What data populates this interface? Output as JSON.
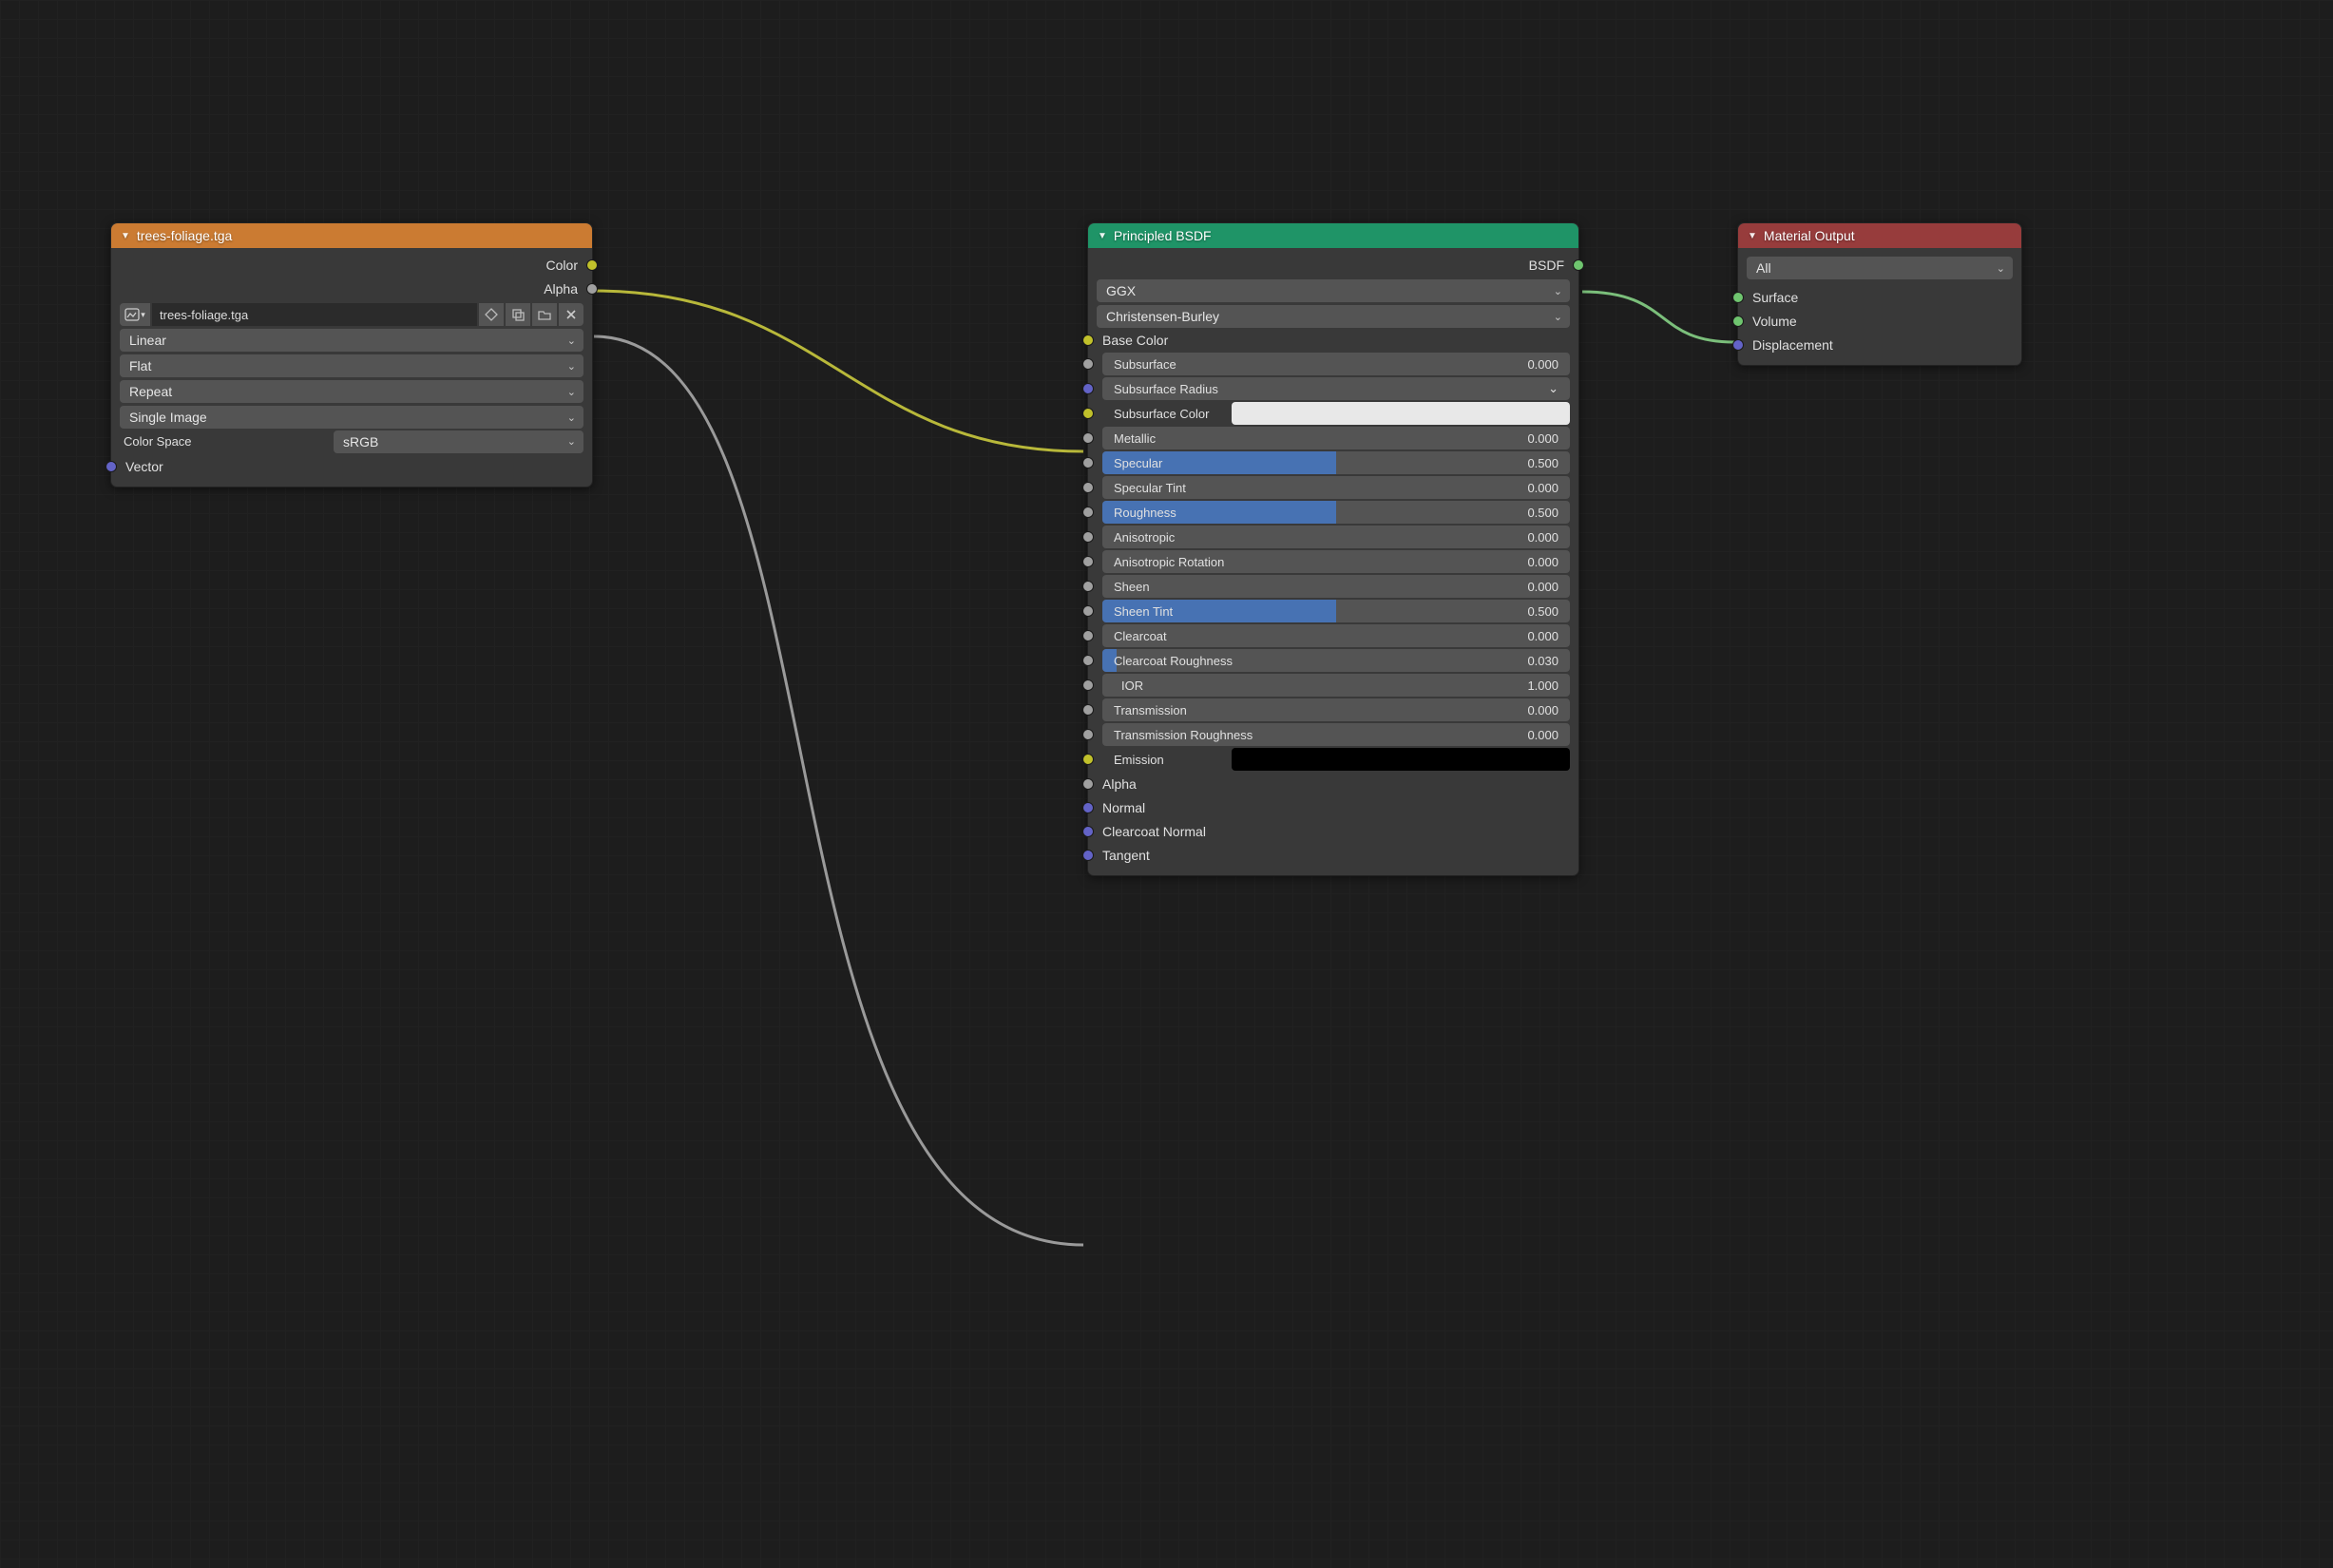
{
  "nodes": {
    "imageTexture": {
      "title": "trees-foliage.tga",
      "outputs": {
        "color": "Color",
        "alpha": "Alpha"
      },
      "imageName": "trees-foliage.tga",
      "interpolation": "Linear",
      "projection": "Flat",
      "extension": "Repeat",
      "source": "Single Image",
      "colorSpaceLabel": "Color Space",
      "colorSpace": "sRGB",
      "vector": "Vector"
    },
    "principled": {
      "title": "Principled BSDF",
      "outputs": {
        "bsdf": "BSDF"
      },
      "distribution": "GGX",
      "subsurfaceMethod": "Christensen-Burley",
      "inputs": {
        "baseColor": "Base Color",
        "subsurface": {
          "label": "Subsurface",
          "value": "0.000",
          "fill": 0
        },
        "subsurfaceRadius": {
          "label": "Subsurface Radius"
        },
        "subsurfaceColor": {
          "label": "Subsurface Color",
          "swatch": "#e8e8e8"
        },
        "metallic": {
          "label": "Metallic",
          "value": "0.000",
          "fill": 0
        },
        "specular": {
          "label": "Specular",
          "value": "0.500",
          "fill": 50
        },
        "specularTint": {
          "label": "Specular Tint",
          "value": "0.000",
          "fill": 0
        },
        "roughness": {
          "label": "Roughness",
          "value": "0.500",
          "fill": 50
        },
        "anisotropic": {
          "label": "Anisotropic",
          "value": "0.000",
          "fill": 0
        },
        "anisotropicRot": {
          "label": "Anisotropic Rotation",
          "value": "0.000",
          "fill": 0
        },
        "sheen": {
          "label": "Sheen",
          "value": "0.000",
          "fill": 0
        },
        "sheenTint": {
          "label": "Sheen Tint",
          "value": "0.500",
          "fill": 50
        },
        "clearcoat": {
          "label": "Clearcoat",
          "value": "0.000",
          "fill": 0
        },
        "clearcoatRough": {
          "label": "Clearcoat Roughness",
          "value": "0.030",
          "fill": 3
        },
        "ior": {
          "label": "IOR",
          "value": "1.000"
        },
        "transmission": {
          "label": "Transmission",
          "value": "0.000",
          "fill": 0
        },
        "transmissionRough": {
          "label": "Transmission Roughness",
          "value": "0.000",
          "fill": 0
        },
        "emission": {
          "label": "Emission",
          "swatch": "#000000"
        },
        "alpha": "Alpha",
        "normal": "Normal",
        "clearcoatNormal": "Clearcoat Normal",
        "tangent": "Tangent"
      }
    },
    "materialOutput": {
      "title": "Material Output",
      "target": "All",
      "inputs": {
        "surface": "Surface",
        "volume": "Volume",
        "displacement": "Displacement"
      }
    }
  },
  "colors": {
    "headerOrange": "#cb7b32",
    "headerGreen": "#1f9467",
    "headerRed": "#973c3c",
    "sliderFill": "#4772b3"
  }
}
